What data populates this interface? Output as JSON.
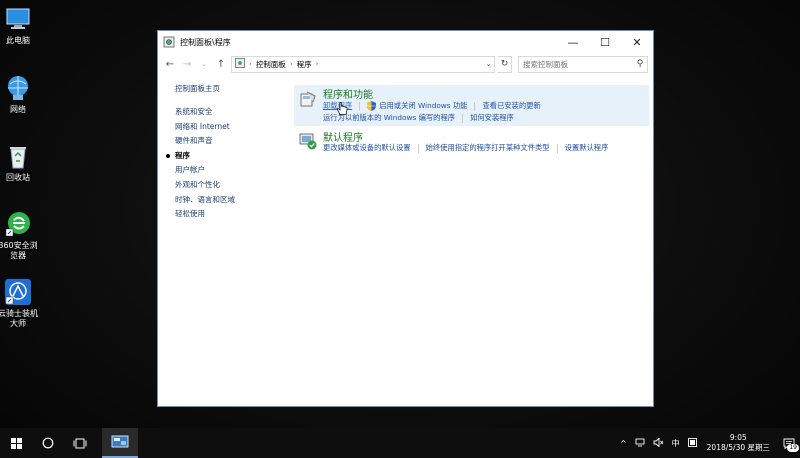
{
  "desktop": {
    "icons": [
      {
        "label": "此电脑",
        "icon": "computer-icon"
      },
      {
        "label": "网络",
        "icon": "network-icon"
      },
      {
        "label": "回收站",
        "icon": "recycle-bin-icon"
      },
      {
        "label": "360安全浏览器",
        "icon": "browser-icon"
      },
      {
        "label": "云骑士装机大师",
        "icon": "installer-icon"
      }
    ]
  },
  "window": {
    "title": "控制面板\\程序",
    "controls": {
      "minimize": "—",
      "maximize": "☐",
      "close": "✕"
    },
    "address": {
      "crumbs": [
        "控制面板",
        "程序"
      ],
      "separator": "›"
    },
    "search": {
      "placeholder": "搜索控制面板"
    },
    "nav": {
      "home": "控制面板主页",
      "items": [
        {
          "label": "系统和安全",
          "active": false
        },
        {
          "label": "网络和 Internet",
          "active": false
        },
        {
          "label": "硬件和声音",
          "active": false
        },
        {
          "label": "程序",
          "active": true
        },
        {
          "label": "用户帐户",
          "active": false
        },
        {
          "label": "外观和个性化",
          "active": false
        },
        {
          "label": "时钟、语言和区域",
          "active": false
        },
        {
          "label": "轻松使用",
          "active": false
        }
      ]
    },
    "sections": {
      "programs": {
        "title": "程序和功能",
        "row1": [
          "卸载程序",
          "启用或关闭 Windows 功能",
          "查看已安装的更新"
        ],
        "row2": [
          "运行为以前版本的 Windows 编写的程序",
          "如何安装程序"
        ]
      },
      "defaults": {
        "title": "默认程序",
        "row1": [
          "更改媒体或设备的默认设置",
          "始终使用指定的程序打开某种文件类型",
          "设置默认程序"
        ]
      }
    }
  },
  "taskbar": {
    "tray": {
      "ime": "中",
      "time": "9:05",
      "date": "2018/5/30 星期三",
      "notifications": "19"
    }
  },
  "colors": {
    "accent": "#1f4fa8",
    "section_title": "#1e7a25",
    "hover_bg": "#e7f1fa"
  }
}
